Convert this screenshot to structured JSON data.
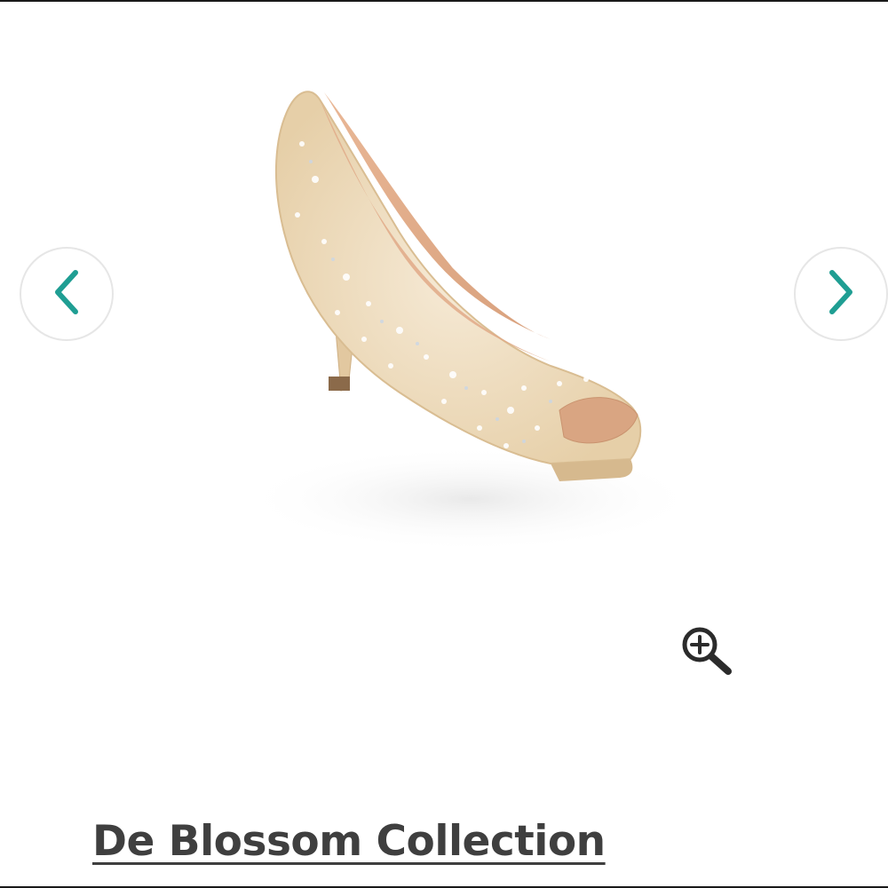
{
  "product": {
    "brand": "De Blossom Collection",
    "image_alt_icon": "shoe-photo"
  },
  "gallery": {
    "prev_icon": "chevron-left-icon",
    "next_icon": "chevron-right-icon",
    "zoom_icon": "zoom-in-icon"
  },
  "colors": {
    "accent": "#1f9e93",
    "text": "#3f3f3f",
    "shoe": "#ecd6b5",
    "shoe_inner": "#e7b592"
  }
}
